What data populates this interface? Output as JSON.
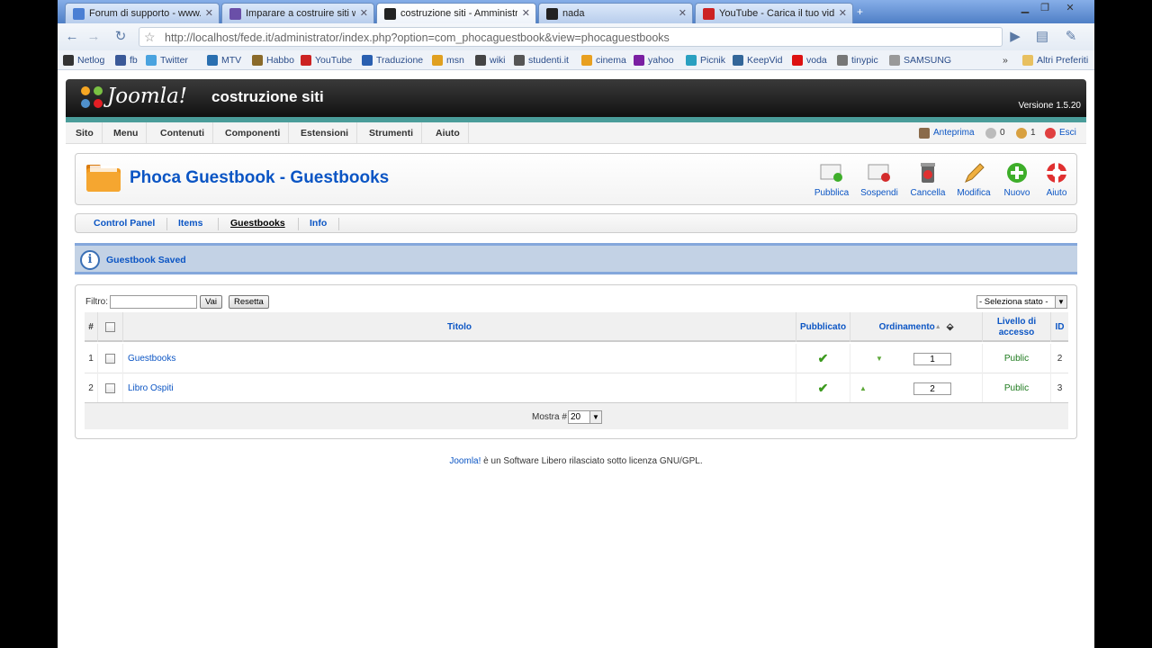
{
  "browser": {
    "tabs": [
      {
        "title": "Forum di supporto - www.y...",
        "favicon_color": "#4a7fd4"
      },
      {
        "title": "Imparare a costruire siti we...",
        "favicon_color": "#6a4fa8"
      },
      {
        "title": "costruzione siti - Amministr...",
        "favicon_color": "#222222"
      },
      {
        "title": "nada",
        "favicon_color": "#222222"
      },
      {
        "title": "YouTube - Carica il tuo video",
        "favicon_color": "#cc2222"
      }
    ],
    "url": "http://localhost/fede.it/administrator/index.php?option=com_phocaguestbook&view=phocaguestbooks",
    "bookmarks": [
      {
        "label": "Netlog",
        "color": "#333333"
      },
      {
        "label": "fb",
        "color": "#3b5998"
      },
      {
        "label": "Twitter",
        "color": "#4aa3df"
      },
      {
        "label": "MTV",
        "color": "#2a6fb0"
      },
      {
        "label": "Habbo",
        "color": "#8a6a2a"
      },
      {
        "label": "YouTube",
        "color": "#cc2222"
      },
      {
        "label": "Traduzione",
        "color": "#2a5fb0"
      },
      {
        "label": "msn",
        "color": "#e0a020"
      },
      {
        "label": "wiki",
        "color": "#444444"
      },
      {
        "label": "studenti.it",
        "color": "#555555"
      },
      {
        "label": "cinema",
        "color": "#e8a020"
      },
      {
        "label": "yahoo",
        "color": "#7a1fa2"
      },
      {
        "label": "Picnik",
        "color": "#2aa0c0"
      },
      {
        "label": "KeepVid",
        "color": "#336699"
      },
      {
        "label": "voda",
        "color": "#dd1111"
      },
      {
        "label": "tinypic",
        "color": "#777777"
      },
      {
        "label": "SAMSUNG",
        "color": "#999999"
      }
    ],
    "other_bookmarks": "Altri Preferiti"
  },
  "joomla": {
    "brand": "Joomla!",
    "site_name": "costruzione siti",
    "version": "Versione 1.5.20",
    "menu": [
      "Sito",
      "Menu",
      "Contenuti",
      "Componenti",
      "Estensioni",
      "Strumenti",
      "Aiuto"
    ],
    "status": {
      "preview": "Anteprima",
      "messages": "0",
      "users": "1",
      "logout": "Esci"
    },
    "page_title": "Phoca Guestbook - Guestbooks",
    "toolbar": [
      {
        "label": "Pubblica",
        "icon": "publish-icon"
      },
      {
        "label": "Sospendi",
        "icon": "unpublish-icon"
      },
      {
        "label": "Cancella",
        "icon": "delete-icon"
      },
      {
        "label": "Modifica",
        "icon": "edit-icon"
      },
      {
        "label": "Nuovo",
        "icon": "new-icon"
      },
      {
        "label": "Aiuto",
        "icon": "help-icon"
      }
    ],
    "submenu": [
      "Control Panel",
      "Items",
      "Guestbooks",
      "Info"
    ],
    "submenu_active": "Guestbooks",
    "message": "Guestbook Saved",
    "filter": {
      "label": "Filtro:",
      "value": "",
      "go": "Vai",
      "reset": "Resetta",
      "state_select": "- Seleziona stato -"
    },
    "table": {
      "headers": {
        "num": "#",
        "title": "Titolo",
        "published": "Pubblicato",
        "ordering": "Ordinamento",
        "access": "Livello di accesso",
        "id": "ID"
      },
      "rows": [
        {
          "num": "1",
          "title": "Guestbooks",
          "order": "1",
          "access": "Public",
          "id": "2"
        },
        {
          "num": "2",
          "title": "Libro Ospiti",
          "order": "2",
          "access": "Public",
          "id": "3"
        }
      ],
      "display_label": "Mostra #",
      "display_value": "20"
    },
    "footer_link": "Joomla!",
    "footer_text": " è un Software Libero rilasciato sotto licenza GNU/GPL."
  }
}
